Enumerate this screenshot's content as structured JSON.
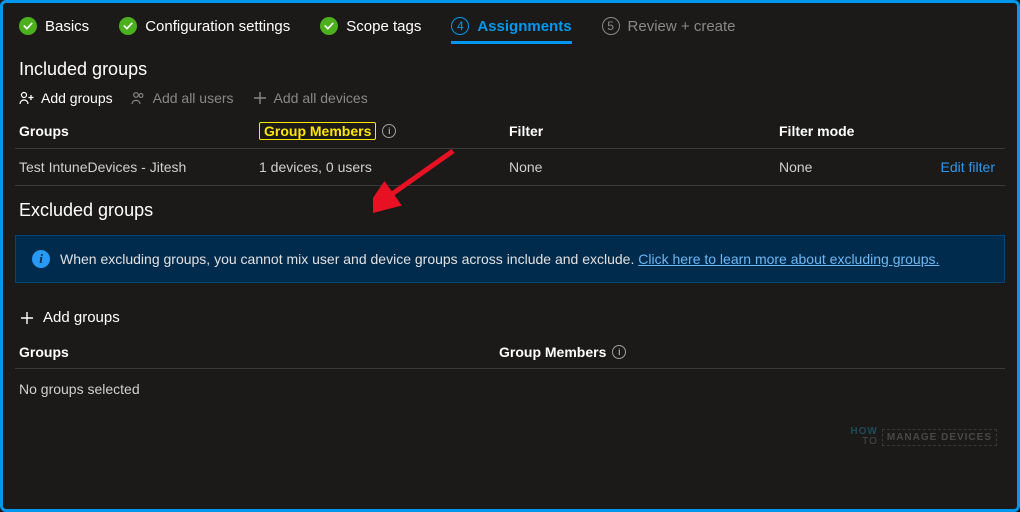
{
  "wizard": {
    "steps": [
      {
        "label": "Basics",
        "state": "done"
      },
      {
        "label": "Configuration settings",
        "state": "done"
      },
      {
        "label": "Scope tags",
        "state": "done"
      },
      {
        "num": "4",
        "label": "Assignments",
        "state": "active"
      },
      {
        "num": "5",
        "label": "Review + create",
        "state": "pending"
      }
    ]
  },
  "included": {
    "title": "Included groups",
    "actions": {
      "add_groups": "Add groups",
      "add_all_users": "Add all users",
      "add_all_devices": "Add all devices"
    },
    "columns": {
      "groups": "Groups",
      "members": "Group Members",
      "filter": "Filter",
      "filter_mode": "Filter mode"
    },
    "rows": [
      {
        "group": "Test IntuneDevices - Jitesh",
        "members": "1 devices, 0 users",
        "filter": "None",
        "filter_mode": "None",
        "edit": "Edit filter"
      }
    ]
  },
  "excluded": {
    "title": "Excluded groups",
    "banner_text": "When excluding groups, you cannot mix user and device groups across include and exclude. ",
    "banner_link": "Click here to learn more about excluding groups.",
    "add_groups": "Add groups",
    "columns": {
      "groups": "Groups",
      "members": "Group Members"
    },
    "empty": "No groups selected"
  },
  "watermark": {
    "how": "HOW",
    "to": "TO",
    "brand": "MANAGE DEVICES"
  }
}
